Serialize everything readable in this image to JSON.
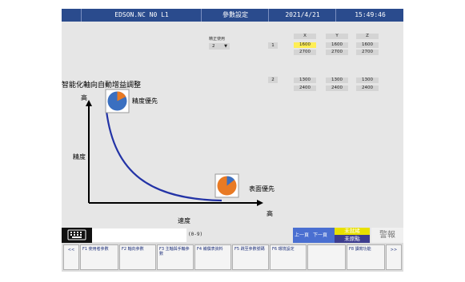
{
  "titlebar": {
    "cell1": "",
    "machine": "EDSON.NC N0 L1",
    "mode": "參數設定",
    "date": "2021/4/21",
    "time": "15:49:46"
  },
  "params": {
    "select_label": "精正使用",
    "select_value": "2",
    "columns": [
      "X",
      "Y",
      "Z"
    ],
    "groups": [
      {
        "index": "1",
        "rows": [
          [
            "1600",
            "1600",
            "1600"
          ],
          [
            "2700",
            "2700",
            "2700"
          ]
        ]
      },
      {
        "index": "2",
        "rows": [
          [
            "1300",
            "1300",
            "1300"
          ],
          [
            "2400",
            "2400",
            "2400"
          ]
        ]
      }
    ]
  },
  "chart": {
    "title": "智能化軸向自動增益調整",
    "y_top_label": "高",
    "y_label": "精度",
    "x_label": "速度",
    "x_right_label": "高",
    "annotation_precision": "精度優先",
    "annotation_surface": "表面優先"
  },
  "status": {
    "input_hint": "(0-9)",
    "page_prev": "上一頁",
    "page_next": "下一頁",
    "not_ready": "未就緒",
    "not_homed": "未原點",
    "alarm": "警報"
  },
  "fkeys": {
    "left_arrow": "<<",
    "right_arrow": ">>",
    "items": [
      "F1 使用者參數",
      "F2 軸向參數",
      "F3 主軸與手輪參數",
      "F4 補償表資料",
      "F5 跳至參數號碼",
      "F6 環境設定",
      "",
      "F8 讀寫功能"
    ]
  },
  "colors": {
    "titlebar": "#2a4b8d",
    "curve": "#2333a6",
    "pie_blue": "#3a6fc0",
    "pie_orange": "#e87a24",
    "highlight": "#ffee55",
    "status_blue": "#4a6fd1",
    "status_yellow": "#e8e000",
    "status_navy": "#3d3d8f"
  }
}
